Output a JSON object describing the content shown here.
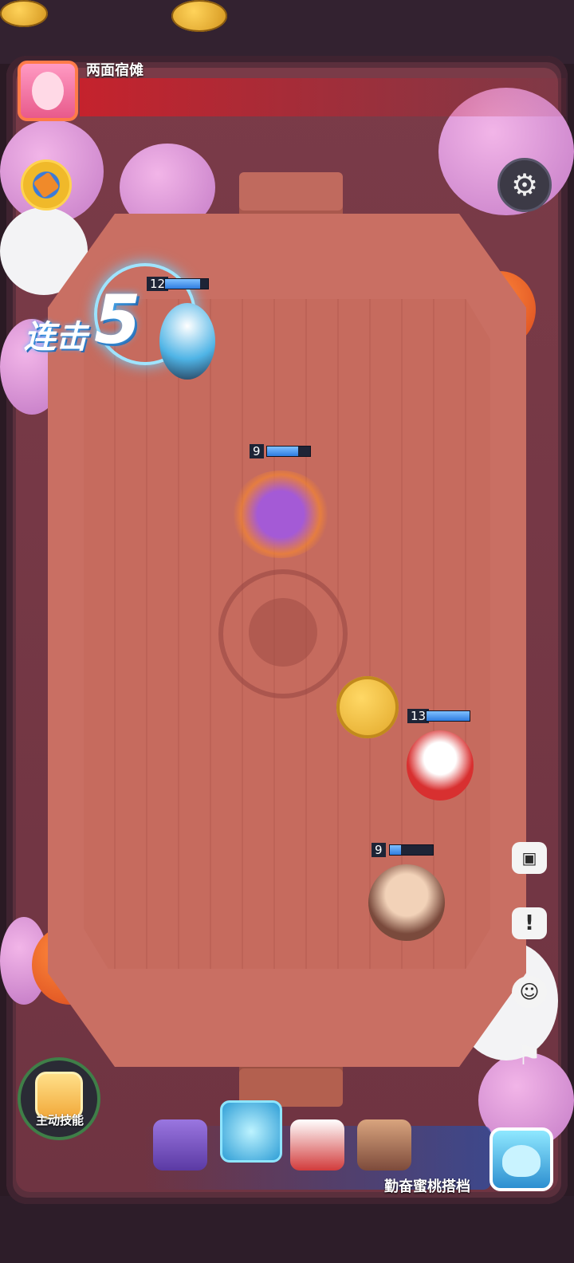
{
  "boss": {
    "name": "两面宿傩",
    "avatar_icon": "fox-mask-girl-portrait"
  },
  "combo": {
    "label": "连击",
    "count": "5"
  },
  "units": [
    {
      "id": "ice-hero",
      "level": "12",
      "hp": 0.82,
      "icon": "ice-spiky-hair-hero"
    },
    {
      "id": "purple-brute",
      "level": "9",
      "hp": 0.72,
      "icon": "purple-sunglasses-brute"
    },
    {
      "id": "red-monkey",
      "level": "13",
      "hp": 1.0,
      "icon": "red-masked-monkey"
    },
    {
      "id": "old-inventor",
      "level": "9",
      "hp": 0.25,
      "icon": "goggles-old-man"
    }
  ],
  "controls": {
    "map_icon": "map-scroll-icon",
    "settings_icon": "gear-icon",
    "robot_icon": "robot-icon",
    "alert_icon": "exclamation-icon",
    "emote_icon": "smile-icon",
    "surrender_icon": "flag-icon"
  },
  "skill": {
    "label": "主动技能",
    "icon": "fist-icon"
  },
  "party": {
    "portraits": [
      "purple-brute-portrait",
      "ice-hero-portrait",
      "red-monkey-portrait",
      "old-inventor-portrait"
    ],
    "partner_label": "勤奋蜜桃搭档",
    "partner_icon": "blue-slime-portrait"
  },
  "colors": {
    "hp_bar": "#2f7de0",
    "boss_bar": "#d21e28",
    "accent_gold": "#f0b92a"
  }
}
